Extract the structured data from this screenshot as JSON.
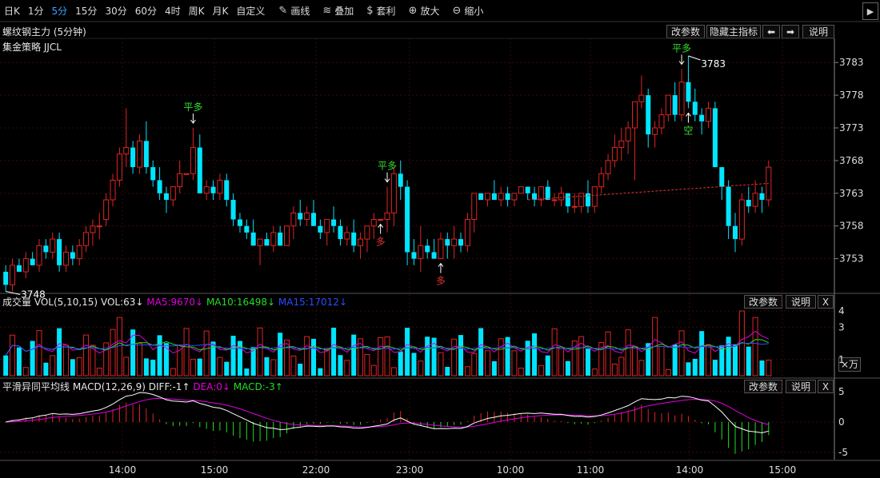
{
  "toolbar": {
    "periods": [
      "日K",
      "1分",
      "5分",
      "15分",
      "30分",
      "60分",
      "4时",
      "周K",
      "月K",
      "自定义"
    ],
    "active_period": "5分",
    "tools": [
      {
        "icon": "pencil-icon",
        "glyph": "✎",
        "label": "画线"
      },
      {
        "icon": "stack-icon",
        "glyph": "≋",
        "label": "叠加"
      },
      {
        "icon": "money-bag-icon",
        "glyph": "$",
        "label": "套利"
      },
      {
        "icon": "zoom-in-icon",
        "glyph": "⊕",
        "label": "放大"
      },
      {
        "icon": "zoom-out-icon",
        "glyph": "⊖",
        "label": "缩小"
      }
    ]
  },
  "main": {
    "title": "螺纹钢主力 (5分钟)",
    "strategy": "集金策略 JJCL",
    "buttons": {
      "params": "改参数",
      "hide": "隐藏主指标",
      "left": "⬅",
      "right": "➡",
      "help": "说明"
    },
    "price_ticks": [
      "3783",
      "3778",
      "3773",
      "3768",
      "3763",
      "3758",
      "3753"
    ],
    "high_label": "3783",
    "low_label": "3748"
  },
  "signals": [
    {
      "text": "平多",
      "color": "#33dd33"
    },
    {
      "text": "多",
      "color": "#e23030"
    },
    {
      "text": "平多",
      "color": "#33dd33"
    },
    {
      "text": "多",
      "color": "#e23030"
    },
    {
      "text": "平多",
      "color": "#33dd33"
    },
    {
      "text": "空",
      "color": "#33dd33"
    }
  ],
  "volume": {
    "label": "成交量 VOL(5,10,15)",
    "vol": "VOL:63↓",
    "ma5": "MA5:9670↓",
    "ma10": "MA10:16498↓",
    "ma15": "MA15:17012↓",
    "ticks": [
      "4",
      "3",
      "1"
    ],
    "unit": "×万",
    "buttons": {
      "params": "改参数",
      "help": "说明",
      "close": "X"
    }
  },
  "macd": {
    "label": "平滑异同平均线 MACD(12,26,9)",
    "diff": "DIFF:-1↑",
    "dea": "DEA:0↓",
    "macd": "MACD:-3↑",
    "ticks": [
      "5",
      "0",
      "-5"
    ],
    "buttons": {
      "params": "改参数",
      "help": "说明",
      "close": "X"
    }
  },
  "time_axis": [
    "14:00",
    "15:00",
    "22:00",
    "23:00",
    "10:00",
    "11:00",
    "14:00",
    "15:00"
  ],
  "colors": {
    "up": "#e02424",
    "down": "#00e5ff",
    "ma5": "#e000e0",
    "ma10": "#22dd22",
    "ma15": "#2d4bff",
    "diff": "#ffffff",
    "dea": "#e000e0",
    "grid": "#3a0a0a",
    "signal_green": "#33dd33",
    "signal_red": "#e23030"
  },
  "chart_data": {
    "type": "candlestick",
    "interval": "5分钟",
    "price_range": [
      3748,
      3785
    ],
    "candles": [
      [
        3751,
        3752,
        3748,
        3749
      ],
      [
        3749,
        3753,
        3748,
        3752
      ],
      [
        3752,
        3753,
        3751,
        3751
      ],
      [
        3751,
        3754,
        3750,
        3753
      ],
      [
        3753,
        3754,
        3752,
        3752
      ],
      [
        3752,
        3756,
        3751,
        3755
      ],
      [
        3755,
        3756,
        3753,
        3754
      ],
      [
        3754,
        3757,
        3753,
        3756
      ],
      [
        3756,
        3757,
        3751,
        3752
      ],
      [
        3752,
        3755,
        3751,
        3754
      ],
      [
        3754,
        3755,
        3752,
        3753
      ],
      [
        3753,
        3756,
        3752,
        3755
      ],
      [
        3755,
        3758,
        3754,
        3757
      ],
      [
        3757,
        3759,
        3755,
        3758
      ],
      [
        3758,
        3760,
        3756,
        3758
      ],
      [
        3759,
        3763,
        3758,
        3762
      ],
      [
        3762,
        3766,
        3761,
        3765
      ],
      [
        3765,
        3770,
        3764,
        3769
      ],
      [
        3769,
        3776,
        3767,
        3770
      ],
      [
        3770,
        3771,
        3766,
        3767
      ],
      [
        3767,
        3772,
        3766,
        3771
      ],
      [
        3771,
        3774,
        3766,
        3767
      ],
      [
        3767,
        3768,
        3764,
        3765
      ],
      [
        3765,
        3767,
        3762,
        3763
      ],
      [
        3763,
        3764,
        3760,
        3762
      ],
      [
        3762,
        3764,
        3761,
        3764
      ],
      [
        3764,
        3768,
        3763,
        3766
      ],
      [
        3766,
        3766,
        3766,
        3766
      ],
      [
        3766,
        3773,
        3765,
        3770
      ],
      [
        3770,
        3772,
        3763,
        3763
      ],
      [
        3763,
        3765,
        3762,
        3764
      ],
      [
        3764,
        3765,
        3762,
        3763
      ],
      [
        3763,
        3766,
        3762,
        3765
      ],
      [
        3765,
        3766,
        3761,
        3762
      ],
      [
        3762,
        3763,
        3758,
        3759
      ],
      [
        3759,
        3760,
        3757,
        3758
      ],
      [
        3758,
        3759,
        3756,
        3757
      ],
      [
        3757,
        3759,
        3755,
        3755
      ],
      [
        3755,
        3756,
        3752,
        3756
      ],
      [
        3756,
        3757,
        3755,
        3755
      ],
      [
        3755,
        3758,
        3754,
        3757
      ],
      [
        3757,
        3758,
        3755,
        3755
      ],
      [
        3755,
        3758,
        3755,
        3758
      ],
      [
        3758,
        3761,
        3756,
        3760
      ],
      [
        3760,
        3762,
        3758,
        3759
      ],
      [
        3759,
        3761,
        3758,
        3760
      ],
      [
        3760,
        3762,
        3758,
        3758
      ],
      [
        3758,
        3759,
        3756,
        3757
      ],
      [
        3757,
        3759,
        3755,
        3759
      ],
      [
        3759,
        3761,
        3757,
        3758
      ],
      [
        3758,
        3759,
        3755,
        3756
      ],
      [
        3756,
        3758,
        3755,
        3757
      ],
      [
        3757,
        3759,
        3754,
        3755
      ],
      [
        3755,
        3757,
        3753,
        3756
      ],
      [
        3756,
        3758,
        3754,
        3758
      ],
      [
        3758,
        3760,
        3756,
        3759
      ],
      [
        3759,
        3759,
        3759,
        3759
      ],
      [
        3759,
        3764,
        3757,
        3760
      ],
      [
        3760,
        3767,
        3758,
        3766
      ],
      [
        3766,
        3768,
        3762,
        3764
      ],
      [
        3764,
        3765,
        3752,
        3754
      ],
      [
        3754,
        3756,
        3752,
        3753
      ],
      [
        3753,
        3758,
        3751,
        3755
      ],
      [
        3755,
        3756,
        3753,
        3754
      ],
      [
        3754,
        3756,
        3753,
        3753
      ],
      [
        3753,
        3757,
        3753,
        3756
      ],
      [
        3756,
        3757,
        3753,
        3755
      ],
      [
        3755,
        3758,
        3753,
        3756
      ],
      [
        3756,
        3757,
        3754,
        3755
      ],
      [
        3755,
        3760,
        3754,
        3759
      ],
      [
        3759,
        3763,
        3757,
        3763
      ],
      [
        3763,
        3763,
        3762,
        3762
      ],
      [
        3762,
        3763,
        3761,
        3763
      ],
      [
        3763,
        3765,
        3762,
        3762
      ],
      [
        3762,
        3764,
        3761,
        3763
      ],
      [
        3763,
        3764,
        3761,
        3762
      ],
      [
        3762,
        3763,
        3761,
        3763
      ],
      [
        3763,
        3764,
        3763,
        3764
      ],
      [
        3764,
        3764,
        3762,
        3763
      ],
      [
        3763,
        3764,
        3761,
        3762
      ],
      [
        3762,
        3764,
        3761,
        3764
      ],
      [
        3764,
        3765,
        3762,
        3762
      ],
      [
        3762,
        3763,
        3761,
        3762
      ],
      [
        3762,
        3764,
        3761,
        3763
      ],
      [
        3763,
        3763,
        3760,
        3761
      ],
      [
        3761,
        3763,
        3760,
        3761
      ],
      [
        3761,
        3763,
        3760,
        3763
      ],
      [
        3763,
        3765,
        3760,
        3761
      ],
      [
        3761,
        3764,
        3760,
        3764
      ],
      [
        3764,
        3767,
        3763,
        3766
      ],
      [
        3766,
        3769,
        3765,
        3768
      ],
      [
        3768,
        3772,
        3767,
        3770
      ],
      [
        3770,
        3773,
        3768,
        3771
      ],
      [
        3771,
        3774,
        3769,
        3773
      ],
      [
        3773,
        3777,
        3765,
        3777
      ],
      [
        3777,
        3781,
        3776,
        3778
      ],
      [
        3778,
        3779,
        3770,
        3772
      ],
      [
        3772,
        3774,
        3770,
        3773
      ],
      [
        3773,
        3776,
        3772,
        3775
      ],
      [
        3775,
        3778,
        3774,
        3778
      ],
      [
        3778,
        3780,
        3774,
        3775
      ],
      [
        3775,
        3782,
        3774,
        3780
      ],
      [
        3780,
        3784,
        3776,
        3777
      ],
      [
        3777,
        3779,
        3774,
        3775
      ],
      [
        3775,
        3776,
        3772,
        3774
      ],
      [
        3774,
        3777,
        3773,
        3776
      ],
      [
        3776,
        3777,
        3767,
        3767
      ],
      [
        3767,
        3766,
        3762,
        3764
      ],
      [
        3764,
        3765,
        3756,
        3758
      ],
      [
        3758,
        3760,
        3754,
        3756
      ],
      [
        3756,
        3763,
        3755,
        3762
      ],
      [
        3762,
        3764,
        3760,
        3761
      ],
      [
        3761,
        3765,
        3760,
        3763
      ],
      [
        3763,
        3764,
        3760,
        3762
      ],
      [
        3762,
        3768,
        3761,
        3767
      ]
    ],
    "volume_ticks": [
      4,
      3,
      1
    ],
    "macd_ticks": [
      5,
      0,
      -5
    ],
    "time_labels": [
      "14:00",
      "15:00",
      "22:00",
      "23:00",
      "10:00",
      "11:00",
      "14:00",
      "15:00"
    ]
  }
}
